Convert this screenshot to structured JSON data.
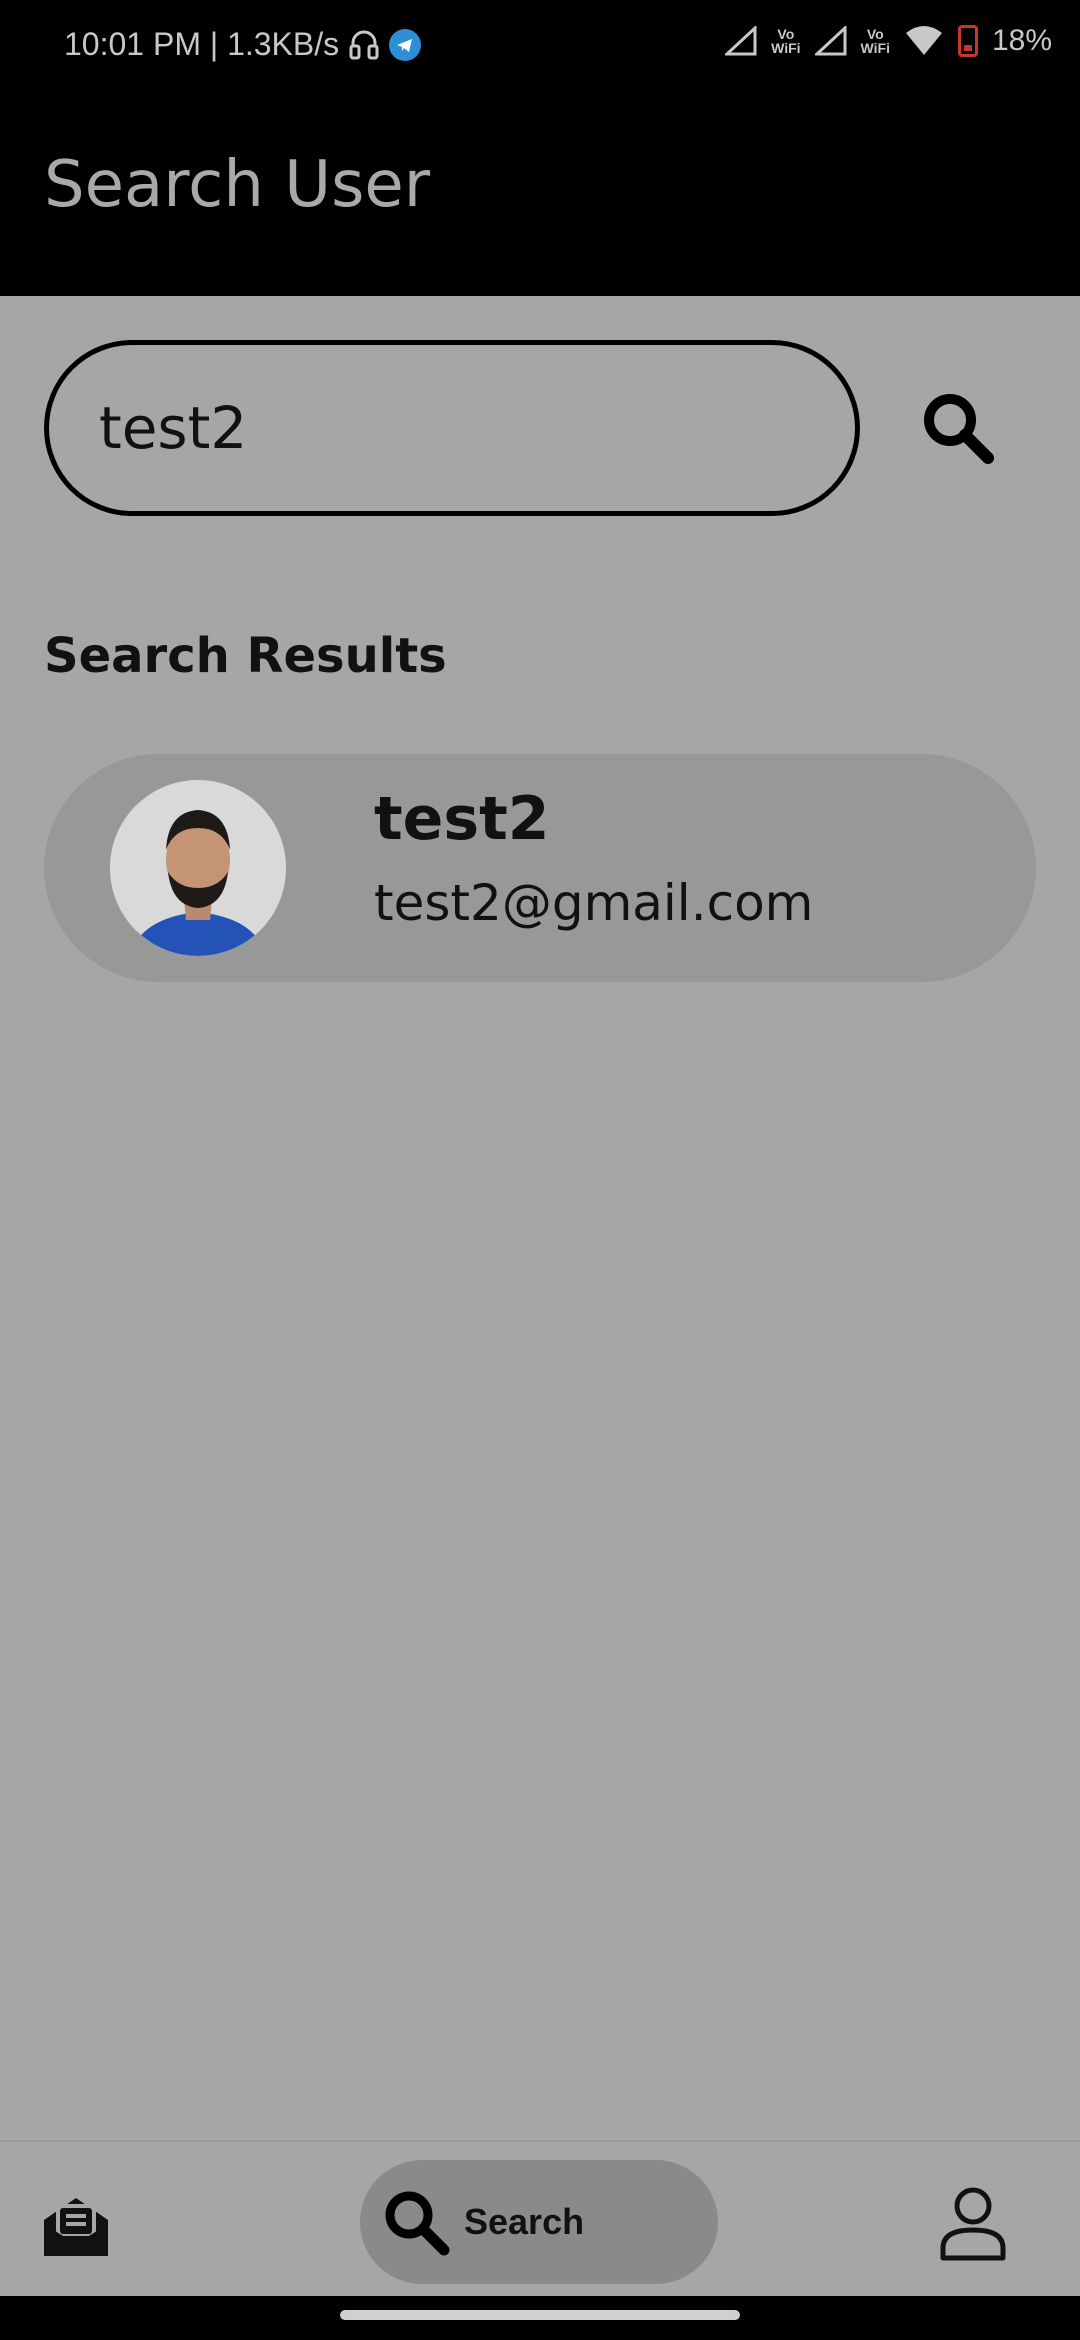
{
  "status_bar": {
    "time_speed": "10:01 PM | 1.3KB/s",
    "vowifi_label": "Vo\nWiFi",
    "battery": "18%",
    "icons": [
      "headset-icon",
      "telegram-icon",
      "signal-icon",
      "vowifi-icon",
      "wifi-icon",
      "battery-icon"
    ]
  },
  "app_bar": {
    "title": "Search User"
  },
  "search": {
    "query": "test2"
  },
  "results": {
    "heading": "Search Results",
    "items": [
      {
        "name": "test2",
        "email": "test2@gmail.com"
      }
    ]
  },
  "bottom_nav": {
    "items": [
      {
        "icon": "inbox-icon"
      },
      {
        "icon": "search-icon",
        "label": "Search",
        "active": true
      },
      {
        "icon": "profile-icon"
      }
    ]
  },
  "colors": {
    "background": "#a6a6a6",
    "app_bar": "#000000",
    "card": "#989898",
    "nav_active_pill": "#8a8a8a",
    "battery_low": "#c0392b"
  }
}
